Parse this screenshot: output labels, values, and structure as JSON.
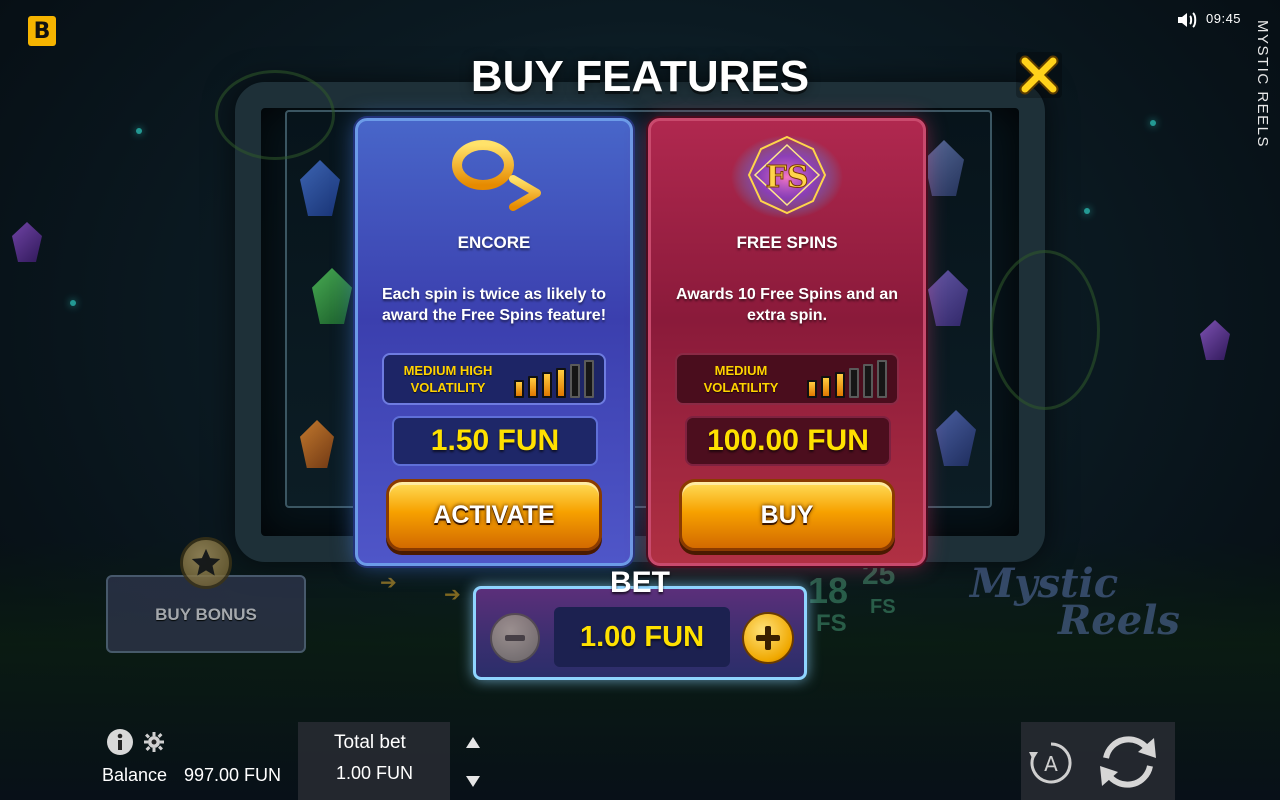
{
  "header": {
    "brand_letter": "B",
    "clock": "09:45",
    "game_title_vertical": "MYSTIC REELS"
  },
  "modal": {
    "title": "BUY FEATURES",
    "close_icon": "close-x-icon",
    "cards": [
      {
        "name": "ENCORE",
        "icon": "encore-loop-arrow-icon",
        "description": "Each spin is twice as likely to award the Free Spins feature!",
        "volatility_line1": "MEDIUM HIGH",
        "volatility_line2": "VOLATILITY",
        "volatility_level": 4,
        "volatility_max": 6,
        "price": "1.50 FUN",
        "button_label": "ACTIVATE"
      },
      {
        "name": "FREE SPINS",
        "icon": "free-spins-fs-badge-icon",
        "badge_text": "FS",
        "description": "Awards 10 Free Spins and an extra spin.",
        "volatility_line1": "MEDIUM",
        "volatility_line2": "VOLATILITY",
        "volatility_level": 3,
        "volatility_max": 6,
        "price": "100.00 FUN",
        "button_label": "BUY"
      }
    ],
    "bet": {
      "label": "BET",
      "value": "1.00 FUN",
      "minus_enabled": false,
      "plus_enabled": true
    }
  },
  "background": {
    "buy_bonus_label": "BUY BONUS",
    "fs_counts": [
      "18",
      "25"
    ],
    "fs_suffix": "FS",
    "logo_line1": "Mystic",
    "logo_line2": "Reels"
  },
  "footer": {
    "balance_label": "Balance",
    "balance_value": "997.00 FUN",
    "total_bet_label": "Total bet",
    "total_bet_value": "1.00 FUN",
    "autoplay_letter": "A"
  },
  "colors": {
    "accent_gold": "#ffe100",
    "encore_card": "#3b3fae",
    "free_spins_card": "#8a1a3a",
    "brand_yellow": "#f6b400"
  }
}
